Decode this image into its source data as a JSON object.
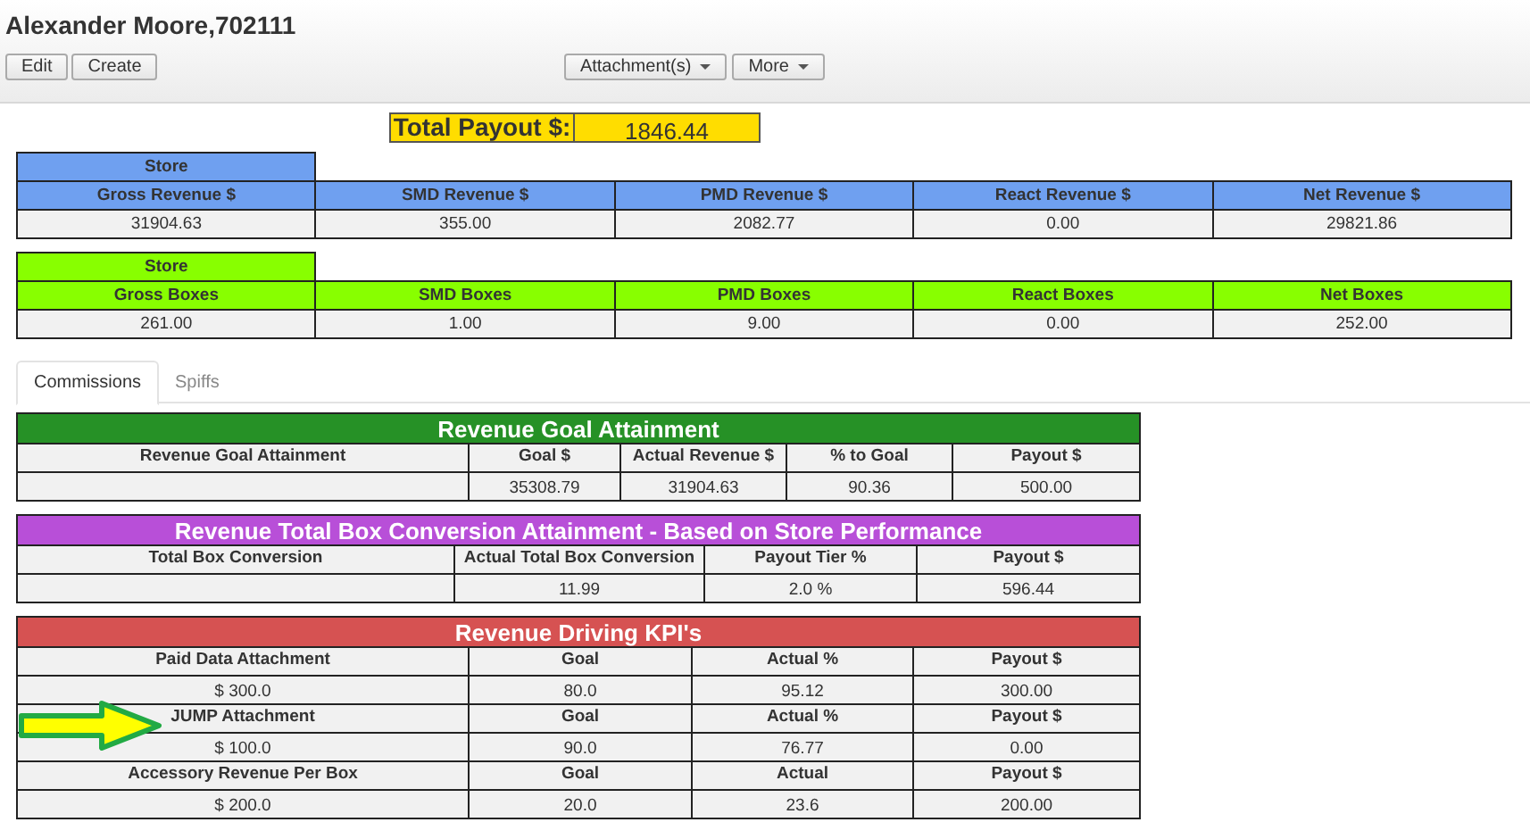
{
  "header": {
    "title": "Alexander Moore,702111"
  },
  "toolbar": {
    "left_buttons": [
      {
        "label": "Edit",
        "dropdown": false
      },
      {
        "label": "Create",
        "dropdown": false
      }
    ],
    "right_buttons": [
      {
        "label": "Attachment(s)",
        "dropdown": true
      },
      {
        "label": "More",
        "dropdown": true
      }
    ]
  },
  "total_payout": {
    "label": "Total Payout $:",
    "value": "1846.44"
  },
  "store_tables": [
    {
      "group_label": "Store",
      "color": "#6fa0f0",
      "columns": [
        "Gross Revenue $",
        "SMD Revenue $",
        "PMD Revenue $",
        "React Revenue $",
        "Net Revenue $"
      ],
      "values": [
        "31904.63",
        "355.00",
        "2082.77",
        "0.00",
        "29821.86"
      ]
    },
    {
      "group_label": "Store",
      "color": "#88ff00",
      "columns": [
        "Gross Boxes",
        "SMD Boxes",
        "PMD Boxes",
        "React Boxes",
        "Net Boxes"
      ],
      "values": [
        "261.00",
        "1.00",
        "9.00",
        "0.00",
        "252.00"
      ]
    }
  ],
  "tabs": [
    {
      "label": "Commissions",
      "selected": true
    },
    {
      "label": "Spiffs",
      "selected": false
    }
  ],
  "sections": [
    {
      "title": "Revenue Goal Attainment",
      "color": "#269126",
      "rows": [
        {
          "kind": "header",
          "cells": [
            "Revenue Goal Attainment",
            "Goal $",
            "Actual Revenue $",
            "% to Goal",
            "Payout $"
          ]
        },
        {
          "kind": "data",
          "cells": [
            "",
            "35308.79",
            "31904.63",
            "90.36",
            "500.00"
          ]
        }
      ]
    },
    {
      "title": "Revenue Total Box Conversion Attainment - Based on Store Performance",
      "color": "#b84fd8",
      "rows": [
        {
          "kind": "header",
          "cells": [
            "Total Box Conversion",
            "Actual Total Box Conversion",
            "Payout Tier %",
            "Payout $"
          ]
        },
        {
          "kind": "data",
          "cells": [
            "",
            "11.99",
            "2.0 %",
            "596.44"
          ]
        }
      ]
    },
    {
      "title": "Revenue Driving KPI's",
      "color": "#d65252",
      "rows": [
        {
          "kind": "header",
          "cells": [
            "Paid Data Attachment",
            "Goal",
            "Actual %",
            "Payout $"
          ]
        },
        {
          "kind": "data",
          "cells": [
            "$ 300.0",
            "80.0",
            "95.12",
            "300.00"
          ]
        },
        {
          "kind": "header",
          "cells": [
            "JUMP Attachment",
            "Goal",
            "Actual %",
            "Payout $"
          ]
        },
        {
          "kind": "data",
          "cells": [
            "$ 100.0",
            "90.0",
            "76.77",
            "0.00"
          ]
        },
        {
          "kind": "header",
          "cells": [
            "Accessory Revenue Per Box",
            "Goal",
            "Actual",
            "Payout $"
          ]
        },
        {
          "kind": "data",
          "cells": [
            "$ 200.0",
            "20.0",
            "23.6",
            "200.00"
          ]
        }
      ]
    }
  ]
}
